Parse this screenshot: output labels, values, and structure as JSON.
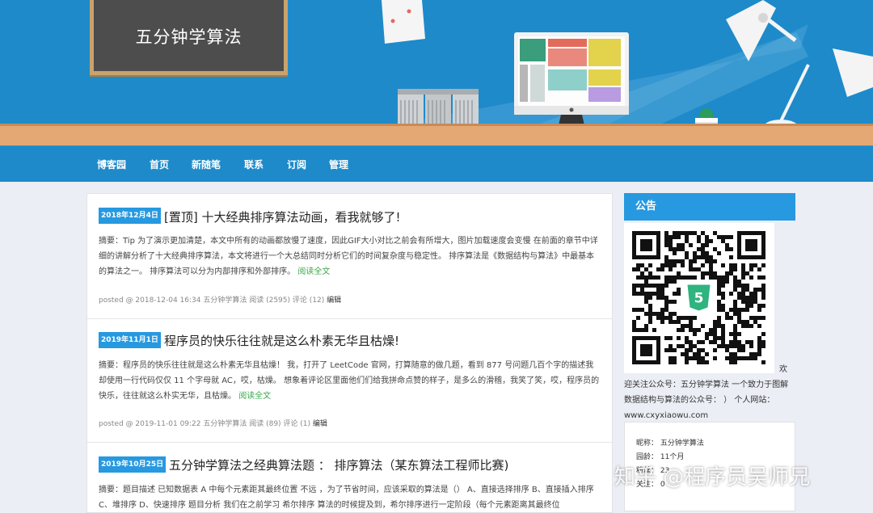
{
  "banner": {
    "title": "五分钟学算法"
  },
  "nav": {
    "items": [
      "博客园",
      "首页",
      "新随笔",
      "联系",
      "订阅",
      "管理"
    ]
  },
  "posts": [
    {
      "date": "2018年12月4日",
      "title": "[置顶] 十大经典排序算法动画，看我就够了!",
      "summary": "摘要：Tip 为了演示更加清楚，本文中所有的动画都放慢了速度，因此GIF大小对比之前会有所增大，图片加载速度会变慢 在前面的章节中详细的讲解分析了十大经典排序算法，本文将进行一个大总结同时分析它们的时间复杂度与稳定性。 排序算法是《数据结构与算法》中最基本的算法之一。 排序算法可以分为内部排序和外部排序。",
      "read_more": "阅读全文",
      "meta": "posted @ 2018-12-04 16:34 五分钟学算法 阅读 (2595) 评论 (12)",
      "edit": "编辑"
    },
    {
      "date": "2019年11月1日",
      "title": "程序员的快乐往往就是这么朴素无华且枯燥!",
      "summary": "摘要：程序员的快乐往往就是这么朴素无华且枯燥！ 我，打开了 LeetCode 官网，打算随意的做几题，看到 877 号问题几百个字的描述我却使用一行代码仅仅 11 个字母就 AC，哎，枯燥。 想象着评论区里面他们们给我拼命点赞的样子，是多么的滑稽，我笑了笑，哎，程序员的快乐，往往就这么朴实无华，且枯燥。",
      "read_more": "阅读全文",
      "meta": "posted @ 2019-11-01 09:22 五分钟学算法 阅读 (89) 评论 (1)",
      "edit": "编辑"
    },
    {
      "date": "2019年10月25日",
      "title": "五分钟学算法之经典算法题 ： 排序算法（某东算法工程师比赛)",
      "summary": "摘要：题目描述 已知数据表 A 中每个元素距其最终位置 不远 ，为了节省时间，应该采取的算法是（） A、直接选择排序 B、直接插入排序 C、堆排序 D、快速排序 题目分析 我们在之前学习 希尔排序 算法的时候提及到，希尔排序进行一定阶段（每个元素距离其最终位"
    }
  ],
  "sidebar": {
    "notice_title": "公告",
    "notice_huan": "欢",
    "notice_body": "迎关注公众号：五分钟学算法 一个致力于图解数据结构与算法的公众号： ） 个人网站：www.cxyxiaowu.com",
    "nickname_label": "昵称：",
    "nickname_value": "五分钟学算法",
    "age_label": "园龄：",
    "age_value": "11个月",
    "followers_label": "粉丝：",
    "followers_value": "23",
    "following_label": "关注：",
    "following_value": "0"
  },
  "watermark": "知乎 @程序员吴师兄",
  "colors": {
    "banner_blue": "#1e8ac9",
    "accent_blue": "#2799e0",
    "read_more_green": "#3aa84b",
    "page_bg": "#eceef5"
  },
  "icons": [
    "html5-icon"
  ]
}
